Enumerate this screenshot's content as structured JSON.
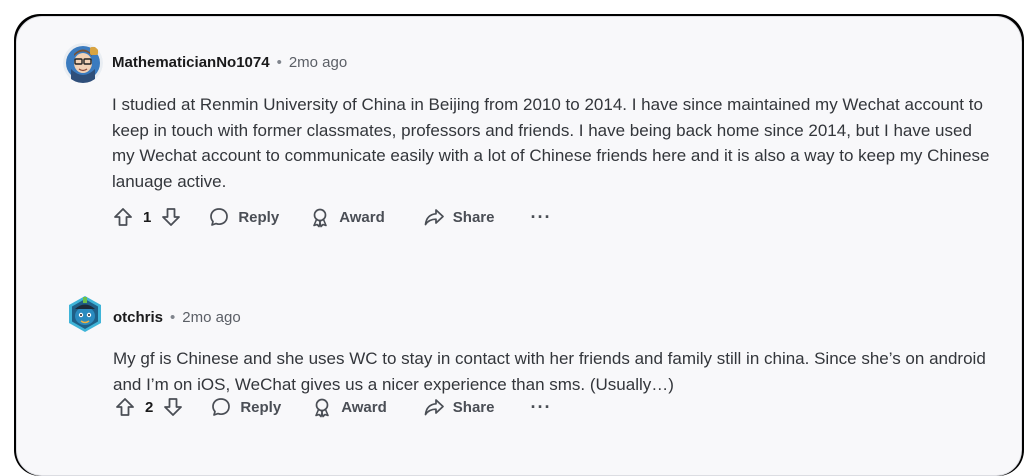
{
  "comments": [
    {
      "username": "MathematicianNo1074",
      "time": "2mo ago",
      "text": "I studied at Renmin University of China in Beijing from 2010 to 2014. I have since maintained my Wechat account to keep in touch with former classmates, professors and friends. I have being back home since 2014, but I have used my Wechat account to communicate easily with a lot of Chinese friends here and it is also a way to keep my Chinese lanuage active.",
      "votes": "1",
      "reply_label": "Reply",
      "award_label": "Award",
      "share_label": "Share",
      "more_label": "···"
    },
    {
      "username": "otchris",
      "time": "2mo ago",
      "text": "My gf is Chinese and she uses WC to stay in contact with her friends and family still in china. Since she’s on android and I’m on iOS, WeChat gives us a nicer experience than sms. (Usually…)",
      "votes": "2",
      "reply_label": "Reply",
      "award_label": "Award",
      "share_label": "Share",
      "more_label": "···"
    }
  ],
  "separator": "•",
  "icons": [
    "upvote-icon",
    "downvote-icon",
    "reply-icon",
    "award-icon",
    "share-icon",
    "more-icon"
  ]
}
